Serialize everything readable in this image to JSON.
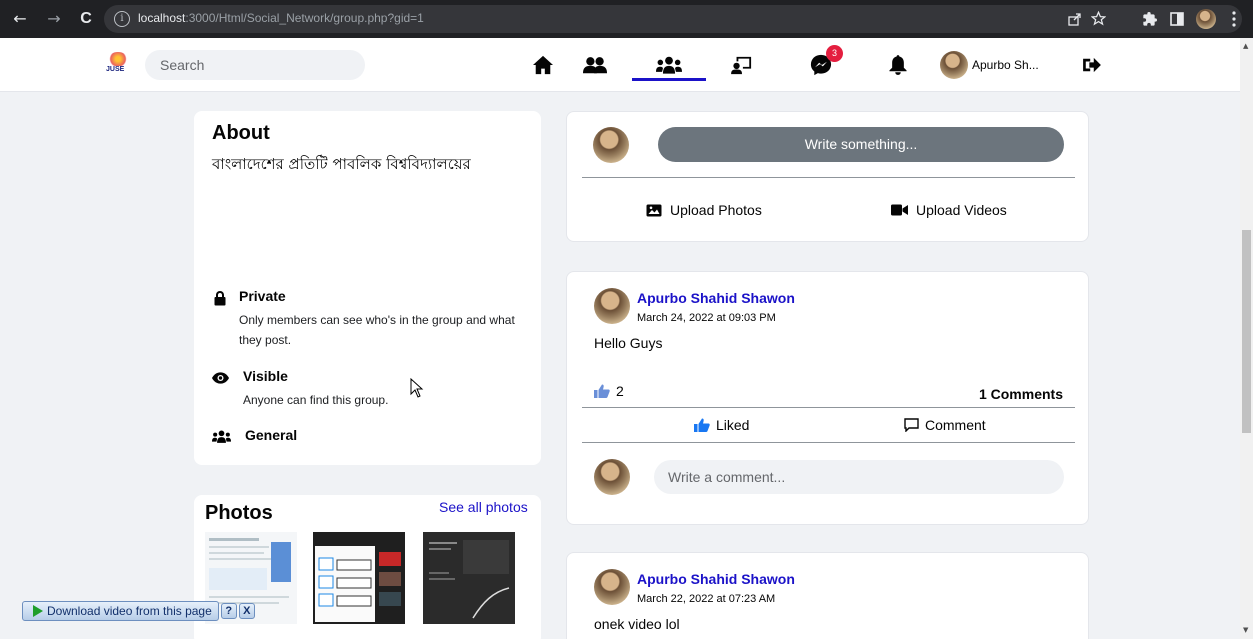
{
  "browser": {
    "url_host": "localhost",
    "url_rest": ":3000/Html/Social_Network/group.php?gid=1",
    "back_icon": "←",
    "forward_icon": "→",
    "reload_icon": "C",
    "info_icon": "i"
  },
  "topnav": {
    "logo_text": "JUSE",
    "search_placeholder": "Search",
    "messenger_badge": "3",
    "user_name": "Apurbo Sh..."
  },
  "about": {
    "title": "About",
    "description": "বাংলাদেশের প্রতিটি পাবলিক বিশ্ববিদ্যালয়ের",
    "private_title": "Private",
    "private_desc": "Only members can see who's in the group and what they post.",
    "visible_title": "Visible",
    "visible_desc": "Anyone can find this group.",
    "general_title": "General"
  },
  "photos": {
    "title": "Photos",
    "see_all": "See all photos"
  },
  "composer": {
    "write_label": "Write something...",
    "upload_photos": "Upload Photos",
    "upload_videos": "Upload Videos"
  },
  "posts": [
    {
      "author": "Apurbo Shahid Shawon",
      "time": "March 24, 2022 at 09:03 PM",
      "text": "Hello Guys",
      "like_count": "2",
      "comments_label": "1 Comments",
      "liked_label": "Liked",
      "comment_label": "Comment",
      "comment_placeholder": "Write a comment..."
    },
    {
      "author": "Apurbo Shahid Shawon",
      "time": "March 22, 2022 at 07:23 AM",
      "text": "onek video lol"
    }
  ],
  "download_widget": {
    "label": "Download video from this page",
    "help": "?",
    "close": "X"
  },
  "colors": {
    "accent": "#1b12c8",
    "badge": "#e41e3f",
    "like_blue": "#1877f2",
    "write_button": "#6c757d"
  }
}
